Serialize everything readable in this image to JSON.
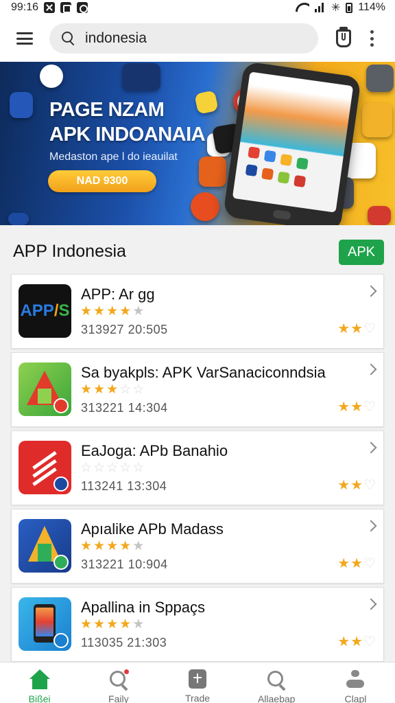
{
  "status_bar": {
    "time": "99:16",
    "battery": "114%",
    "icons": [
      "x-square-icon",
      "b-square-icon",
      "c-square-icon",
      "wifi-icon",
      "signal-icon",
      "bluetooth-icon",
      "battery-icon"
    ]
  },
  "header": {
    "search_value": "indonesia",
    "icons": [
      "menu-icon",
      "search-icon",
      "bag-icon",
      "more-vertical-icon"
    ]
  },
  "banner": {
    "title": "PAGE NZAM\nAPK INDOANAIA",
    "subtitle": "Medaston ape l do ieauilat",
    "cta_label": "NAD 9300",
    "colors": {
      "left": "#0d2a5a",
      "right": "#f7c12a",
      "cta": "#f2a11a"
    }
  },
  "section": {
    "title": "APP Indonesia",
    "badge": "APK",
    "badge_color": "#1ea34a"
  },
  "apps": [
    {
      "name": "APP: Ar gg",
      "rating_filled": 4,
      "rating_total": 5,
      "meta": "313927  20:505",
      "mini_rating": 2,
      "icon": "apps-logo-icon"
    },
    {
      "name": "Sa byakpls: APK VarSanaciconndsia",
      "rating_filled": 3,
      "rating_total": 5,
      "meta": "313221  14:304",
      "mini_rating": 2,
      "icon": "green-a-logo-icon"
    },
    {
      "name": "EaJoga: APb Banahio",
      "rating_filled": 0,
      "rating_total": 5,
      "meta": "113241  13:304",
      "mini_rating": 2,
      "icon": "red-stripes-logo-icon"
    },
    {
      "name": "Apıalike APb Madass",
      "rating_filled": 4,
      "rating_total": 5,
      "meta": "313221  10:904",
      "mini_rating": 2,
      "icon": "blue-a-logo-icon"
    },
    {
      "name": "Apallina in Sppaçs",
      "rating_filled": 4,
      "rating_total": 5,
      "meta": "113035  21:303",
      "mini_rating": 2,
      "icon": "phone-logo-icon"
    }
  ],
  "bottom_nav": [
    {
      "label": "Bißei",
      "icon": "home-icon",
      "active": true
    },
    {
      "label": "Faily",
      "icon": "search-icon",
      "active": false
    },
    {
      "label": "Trade",
      "icon": "bag-plus-icon",
      "active": false
    },
    {
      "label": "Allaebap",
      "icon": "search-icon",
      "active": false
    },
    {
      "label": "Clapl",
      "icon": "user-icon",
      "active": false
    }
  ]
}
